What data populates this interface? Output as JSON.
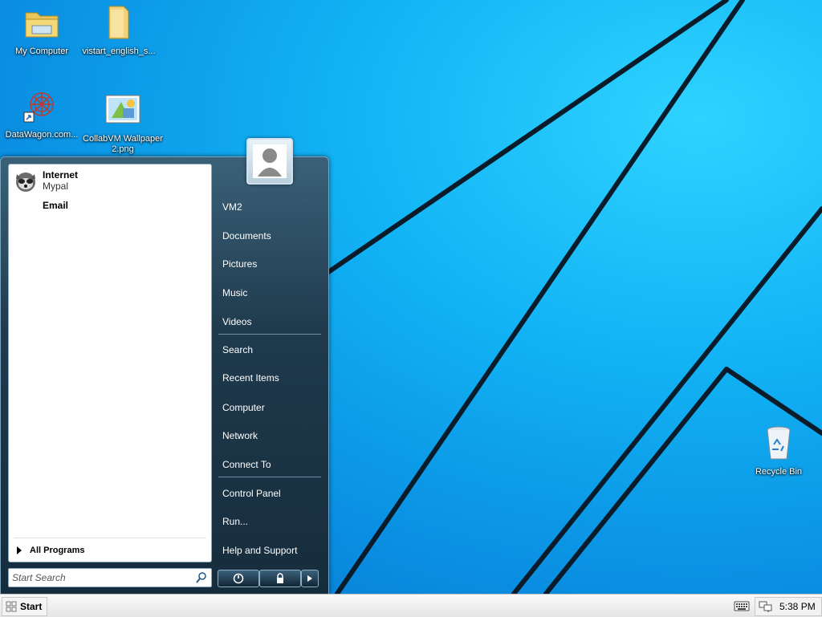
{
  "desktop": {
    "icons": [
      {
        "label": "My Computer"
      },
      {
        "label": "vistart_english_s..."
      },
      {
        "label": "DataWagon.com..."
      },
      {
        "label": "CollabVM Wallpaper 2.png"
      },
      {
        "label": "Recycle Bin"
      }
    ]
  },
  "start_menu": {
    "pinned": {
      "internet_title": "Internet",
      "internet_subtitle": "Mypal",
      "email_title": "Email"
    },
    "all_programs": "All Programs",
    "search_placeholder": "Start Search",
    "right_items": [
      "VM2",
      "Documents",
      "Pictures",
      "Music",
      "Videos",
      "Search",
      "Recent Items",
      "Computer",
      "Network",
      "Connect To",
      "Control Panel",
      "Run...",
      "Help and Support"
    ]
  },
  "taskbar": {
    "start_label": "Start",
    "clock": "5:38 PM"
  },
  "colors": {
    "wallpaper_blue": "#12b4f5",
    "menu_dark": "#1f3a4d"
  }
}
